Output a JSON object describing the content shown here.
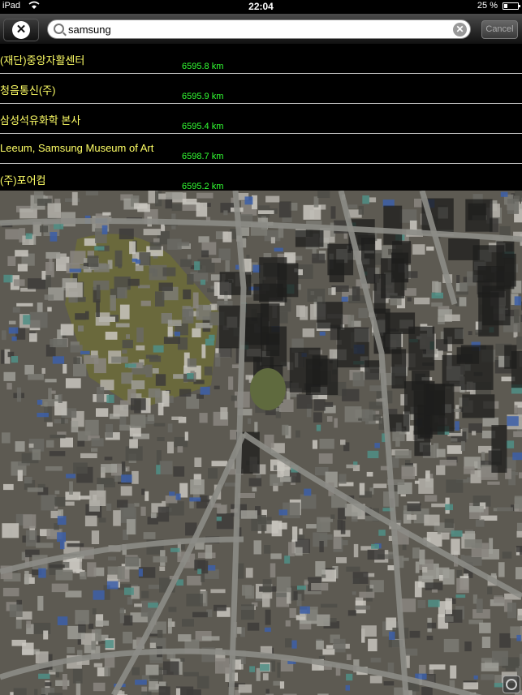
{
  "status": {
    "device": "iPad",
    "time": "22:04",
    "battery": "25 %",
    "battery_level": 0.25
  },
  "toolbar": {
    "close_icon": "close-icon",
    "search": {
      "value": "samsung",
      "placeholder": ""
    },
    "cancel_label": "Cancel"
  },
  "results": [
    {
      "name": "(재단)중앙자활센터",
      "distance": "6595.8 km"
    },
    {
      "name": "청음통신(주)",
      "distance": "6595.9 km"
    },
    {
      "name": "삼성석유화학 본사",
      "distance": "6595.4 km"
    },
    {
      "name": "Leeum, Samsung Museum of Art",
      "distance": "6598.7 km"
    },
    {
      "name": "(주)포어컴",
      "distance": "6595.2 km"
    }
  ],
  "map": {
    "type": "satellite",
    "colors": {
      "ground": "#5d5a52",
      "road": "#8c8c86",
      "park": "#6b6a3a",
      "roof": "#a6a6a0"
    }
  }
}
